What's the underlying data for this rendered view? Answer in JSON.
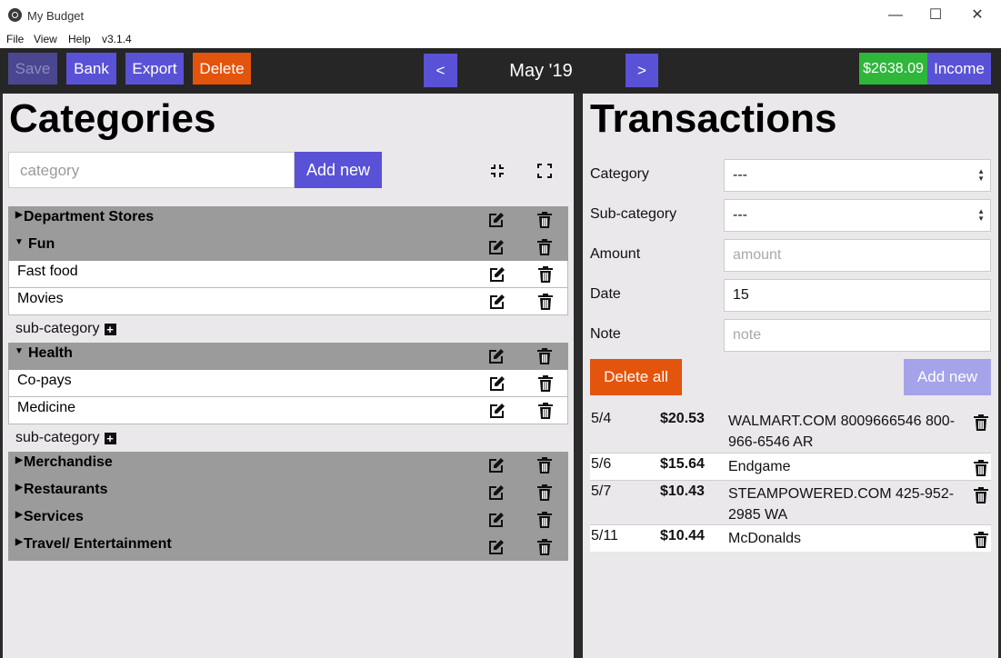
{
  "window": {
    "title": "My Budget",
    "icons": {
      "app": "electron-icon",
      "minimize": "minimize-icon",
      "maximize": "maximize-icon",
      "close": "close-icon"
    },
    "controls": {
      "minimize": "—",
      "maximize": "☐",
      "close": "✕"
    }
  },
  "menu": {
    "items": [
      "File",
      "View",
      "Help"
    ],
    "version": "v3.1.4"
  },
  "toolbar": {
    "save": "Save",
    "bank": "Bank",
    "export": "Export",
    "delete": "Delete",
    "prev": "<",
    "month": "May '19",
    "next": ">",
    "balance": "$2638.09",
    "income": "Income"
  },
  "colors": {
    "accent": "#5a52d6",
    "danger": "#e3540c",
    "balance": "#2eb73b",
    "disabled": "#4a4790",
    "panel": "#eae8ea",
    "category_row": "#9b9b9b"
  },
  "categories": {
    "title": "Categories",
    "input_placeholder": "category",
    "add_label": "Add new",
    "subcategory_add_label": "sub-category",
    "icons": {
      "collapse_all": "collapse-icon",
      "expand_all": "expand-icon",
      "edit": "edit-icon",
      "delete": "trash-icon",
      "add": "plus-icon"
    },
    "items": [
      {
        "name": "Department Stores",
        "expanded": false
      },
      {
        "name": "Fun",
        "expanded": true,
        "subs": [
          "Fast food",
          "Movies"
        ]
      },
      {
        "name": "Health",
        "expanded": true,
        "subs": [
          "Co-pays",
          "Medicine"
        ]
      },
      {
        "name": "Merchandise",
        "expanded": false
      },
      {
        "name": "Restaurants",
        "expanded": false
      },
      {
        "name": "Services",
        "expanded": false
      },
      {
        "name": "Travel/ Entertainment",
        "expanded": false
      }
    ]
  },
  "transactions": {
    "title": "Transactions",
    "form": {
      "category_label": "Category",
      "category_value": "---",
      "subcategory_label": "Sub-category",
      "subcategory_value": "---",
      "amount_label": "Amount",
      "amount_placeholder": "amount",
      "date_label": "Date",
      "date_value": "15",
      "note_label": "Note",
      "note_placeholder": "note"
    },
    "delete_all_label": "Delete all",
    "add_label": "Add new",
    "items": [
      {
        "date": "5/4",
        "amount": "$20.53",
        "description": "WALMART.COM 8009666546 800-966-6546 AR"
      },
      {
        "date": "5/6",
        "amount": "$15.64",
        "description": "Endgame"
      },
      {
        "date": "5/7",
        "amount": "$10.43",
        "description": "STEAMPOWERED.COM 425-952-2985 WA"
      },
      {
        "date": "5/11",
        "amount": "$10.44",
        "description": "McDonalds"
      }
    ]
  }
}
